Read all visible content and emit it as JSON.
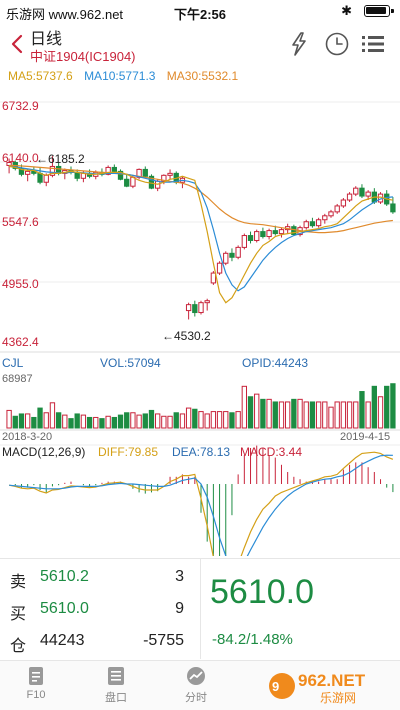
{
  "status_bar": {
    "carrier": "乐游网 www.962.net",
    "time": "下午2:56"
  },
  "header": {
    "title": "日线",
    "subtitle": "中证1904(IC1904)"
  },
  "icons": {
    "back": "chevron-left-icon",
    "bolt": "lightning-icon",
    "clock": "clock-icon",
    "menu": "list-menu-icon"
  },
  "ma": {
    "ma5": "MA5:5737.6",
    "ma10": "MA10:5771.3",
    "ma30": "MA30:5532.1"
  },
  "colors": {
    "up": "#c8233a",
    "down": "#1d8c43",
    "ma5": "#d4a017",
    "ma10": "#2b8cd6",
    "ma30": "#e08a2c",
    "macd_dif": "#d4a017",
    "macd_dea": "#2b8cd6"
  },
  "chart_data": {
    "type": "candlestick",
    "y_ticks": [
      "6732.9",
      "6140.0",
      "5547.6",
      "4955.0",
      "4362.4"
    ],
    "ylim": [
      4362.4,
      6732.9
    ],
    "annotations": {
      "high": "6185.2",
      "low": "4530.2"
    },
    "x_start": "2018-3-20",
    "x_end": "2019-4-15",
    "candles": [
      [
        6090,
        6160,
        6010,
        6120
      ],
      [
        6120,
        6140,
        6040,
        6060
      ],
      [
        6060,
        6100,
        5980,
        6000
      ],
      [
        6000,
        6050,
        5930,
        6030
      ],
      [
        6030,
        6080,
        5990,
        6010
      ],
      [
        6010,
        6070,
        5900,
        5920
      ],
      [
        5920,
        6010,
        5880,
        5990
      ],
      [
        5990,
        6185,
        5970,
        6080
      ],
      [
        6080,
        6120,
        5990,
        6010
      ],
      [
        6010,
        6060,
        5950,
        6040
      ],
      [
        6040,
        6080,
        6000,
        6020
      ],
      [
        6020,
        6050,
        5930,
        5960
      ],
      [
        5960,
        6030,
        5920,
        6010
      ],
      [
        6010,
        6050,
        5960,
        5980
      ],
      [
        5980,
        6040,
        5950,
        6020
      ],
      [
        6020,
        6060,
        5980,
        6000
      ],
      [
        6000,
        6090,
        5990,
        6070
      ],
      [
        6070,
        6100,
        6010,
        6030
      ],
      [
        6030,
        6050,
        5940,
        5950
      ],
      [
        5950,
        6000,
        5870,
        5880
      ],
      [
        5880,
        5990,
        5860,
        5970
      ],
      [
        5970,
        6060,
        5950,
        6050
      ],
      [
        6050,
        6080,
        5960,
        5980
      ],
      [
        5980,
        6000,
        5850,
        5860
      ],
      [
        5860,
        5950,
        5830,
        5930
      ],
      [
        5930,
        6000,
        5900,
        5990
      ],
      [
        5990,
        6050,
        5950,
        6010
      ],
      [
        6010,
        6030,
        5900,
        5920
      ],
      [
        5920,
        5980,
        5860,
        5960
      ],
      [
        4620,
        4700,
        4530,
        4680
      ],
      [
        4680,
        4720,
        4560,
        4600
      ],
      [
        4600,
        4720,
        4580,
        4700
      ],
      [
        4700,
        4740,
        4620,
        4720
      ],
      [
        4900,
        5020,
        4880,
        5000
      ],
      [
        5000,
        5120,
        4980,
        5100
      ],
      [
        5100,
        5220,
        5080,
        5200
      ],
      [
        5200,
        5250,
        5120,
        5160
      ],
      [
        5160,
        5280,
        5140,
        5260
      ],
      [
        5260,
        5400,
        5240,
        5380
      ],
      [
        5380,
        5420,
        5300,
        5330
      ],
      [
        5330,
        5440,
        5310,
        5420
      ],
      [
        5420,
        5460,
        5350,
        5370
      ],
      [
        5370,
        5450,
        5340,
        5430
      ],
      [
        5430,
        5480,
        5380,
        5400
      ],
      [
        5400,
        5460,
        5360,
        5440
      ],
      [
        5440,
        5500,
        5400,
        5470
      ],
      [
        5470,
        5490,
        5380,
        5390
      ],
      [
        5390,
        5480,
        5370,
        5460
      ],
      [
        5460,
        5540,
        5440,
        5520
      ],
      [
        5520,
        5560,
        5460,
        5480
      ],
      [
        5480,
        5560,
        5460,
        5540
      ],
      [
        5540,
        5600,
        5500,
        5580
      ],
      [
        5580,
        5640,
        5560,
        5620
      ],
      [
        5620,
        5700,
        5600,
        5680
      ],
      [
        5680,
        5760,
        5660,
        5740
      ],
      [
        5740,
        5820,
        5720,
        5800
      ],
      [
        5800,
        5880,
        5780,
        5860
      ],
      [
        5860,
        5900,
        5760,
        5780
      ],
      [
        5780,
        5840,
        5740,
        5820
      ],
      [
        5820,
        5860,
        5700,
        5720
      ],
      [
        5720,
        5820,
        5700,
        5800
      ],
      [
        5800,
        5840,
        5680,
        5700
      ],
      [
        5700,
        5770,
        5600,
        5620
      ]
    ],
    "ma5": [
      6080,
      6070,
      6050,
      6040,
      6040,
      6010,
      5990,
      6010,
      6010,
      6020,
      6030,
      6020,
      6010,
      6000,
      6000,
      6010,
      6020,
      6020,
      6020,
      6000,
      5970,
      5940,
      5920,
      5910,
      5900,
      5920,
      5950,
      5960,
      5980,
      5960,
      5940,
      5700,
      5420,
      5100,
      4800,
      4700,
      4750,
      4860,
      4980,
      5100,
      5200,
      5280,
      5320,
      5370,
      5390,
      5400,
      5410,
      5420,
      5430,
      5440,
      5450,
      5470,
      5480,
      5500,
      5560,
      5620,
      5680,
      5730,
      5750,
      5770,
      5770,
      5750,
      5737.6
    ],
    "ma10": [
      6080,
      6075,
      6065,
      6055,
      6045,
      6035,
      6025,
      6020,
      6015,
      6015,
      6020,
      6020,
      6015,
      6010,
      6005,
      6005,
      6010,
      6010,
      6010,
      6000,
      5990,
      5975,
      5960,
      5945,
      5930,
      5920,
      5920,
      5930,
      5940,
      5930,
      5910,
      5820,
      5660,
      5440,
      5200,
      5000,
      4880,
      4820,
      4860,
      4950,
      5040,
      5130,
      5200,
      5260,
      5310,
      5350,
      5380,
      5400,
      5420,
      5430,
      5440,
      5450,
      5460,
      5480,
      5500,
      5540,
      5590,
      5640,
      5680,
      5720,
      5750,
      5765,
      5771.3
    ],
    "ma30": [
      6090,
      6090,
      6085,
      6080,
      6075,
      6070,
      6065,
      6060,
      6055,
      6050,
      6045,
      6040,
      6035,
      6030,
      6025,
      6020,
      6015,
      6010,
      6005,
      6000,
      5990,
      5980,
      5970,
      5960,
      5950,
      5940,
      5930,
      5920,
      5910,
      5890,
      5860,
      5820,
      5770,
      5710,
      5650,
      5600,
      5560,
      5530,
      5510,
      5500,
      5495,
      5490,
      5480,
      5470,
      5460,
      5450,
      5440,
      5430,
      5420,
      5415,
      5410,
      5410,
      5415,
      5420,
      5430,
      5445,
      5460,
      5475,
      5490,
      5505,
      5515,
      5525,
      5532.1
    ],
    "volume": {
      "cjl_label": "CJL",
      "vol_label": "VOL:57094",
      "opid_label": "OPID:44243",
      "max_label": "68987"
    },
    "macd": {
      "label": "MACD(12,26,9)",
      "dif": "DIFF:79.85",
      "dea": "DEA:78.13",
      "macd": "MACD:3.44"
    }
  },
  "quote": {
    "sell_label": "卖",
    "sell_price": "5610.2",
    "sell_qty": "3",
    "buy_label": "买",
    "buy_price": "5610.0",
    "buy_qty": "9",
    "oi_label": "仓",
    "oi_value": "44243",
    "oi_change": "-5755",
    "last_price": "5610.0",
    "change": "-84.2/1.48%"
  },
  "tabs": [
    {
      "label": "F10",
      "icon": "document-icon"
    },
    {
      "label": "盘口",
      "icon": "order-book-icon"
    },
    {
      "label": "分时",
      "icon": "timeshare-icon"
    }
  ],
  "watermark": {
    "text": "962.NET",
    "sub": "乐游网"
  }
}
